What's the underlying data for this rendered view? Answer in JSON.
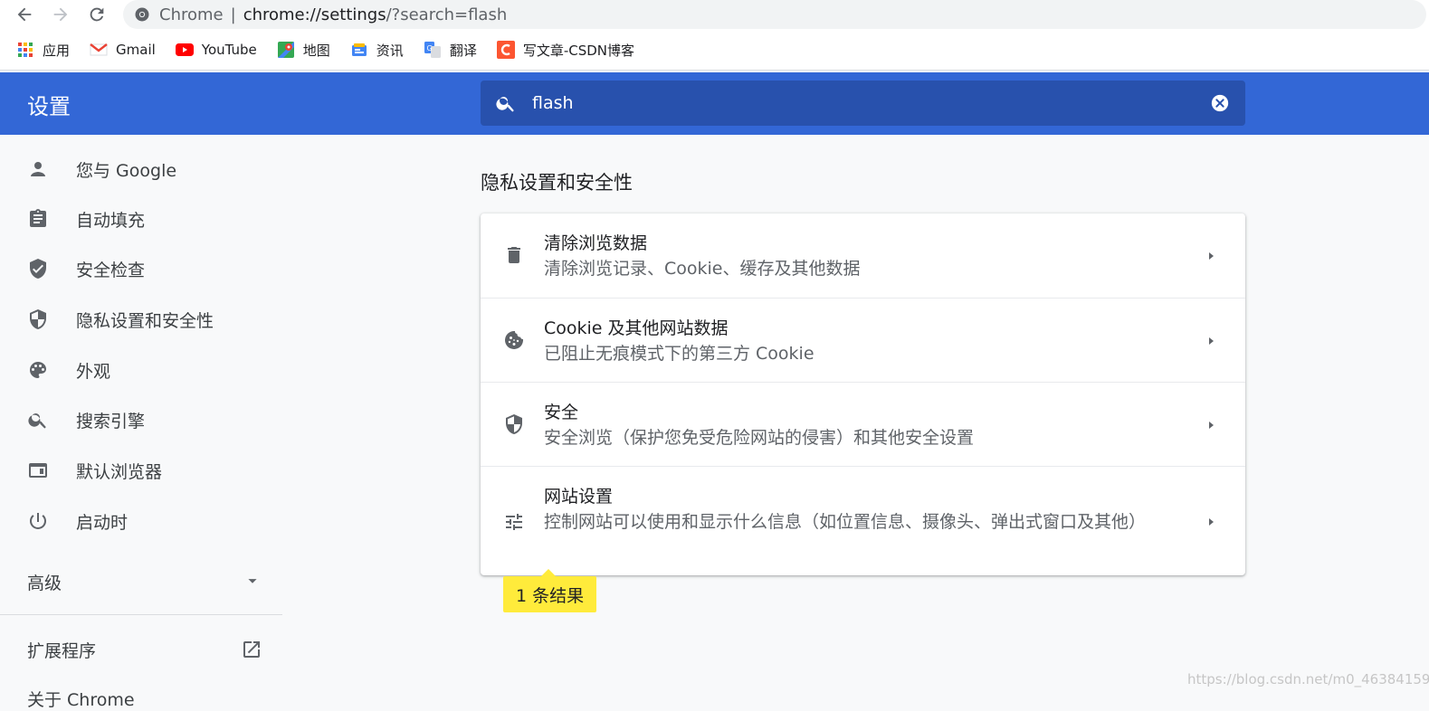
{
  "browser": {
    "scheme_label": "Chrome",
    "url_host": "chrome://settings",
    "url_rest": "/?search=flash"
  },
  "bookmarks": [
    {
      "label": "应用",
      "icon": "apps-grid-icon"
    },
    {
      "label": "Gmail",
      "icon": "gmail-icon"
    },
    {
      "label": "YouTube",
      "icon": "youtube-icon"
    },
    {
      "label": "地图",
      "icon": "maps-icon"
    },
    {
      "label": "资讯",
      "icon": "news-icon"
    },
    {
      "label": "翻译",
      "icon": "translate-icon"
    },
    {
      "label": "写文章-CSDN博客",
      "icon": "csdn-icon"
    }
  ],
  "header": {
    "title": "设置",
    "search_value": "flash"
  },
  "sidebar": {
    "items": [
      {
        "label": "您与 Google",
        "icon": "person-icon"
      },
      {
        "label": "自动填充",
        "icon": "clipboard-icon"
      },
      {
        "label": "安全检查",
        "icon": "shield-check-icon"
      },
      {
        "label": "隐私设置和安全性",
        "icon": "shield-half-icon"
      },
      {
        "label": "外观",
        "icon": "palette-icon"
      },
      {
        "label": "搜索引擎",
        "icon": "search-icon"
      },
      {
        "label": "默认浏览器",
        "icon": "browser-window-icon"
      },
      {
        "label": "启动时",
        "icon": "power-icon"
      }
    ],
    "advanced_label": "高级",
    "extensions_label": "扩展程序",
    "about_label": "关于 Chrome"
  },
  "main": {
    "section_title": "隐私设置和安全性",
    "rows": [
      {
        "title": "清除浏览数据",
        "subtitle": "清除浏览记录、Cookie、缓存及其他数据",
        "icon": "trash-icon"
      },
      {
        "title": "Cookie 及其他网站数据",
        "subtitle": "已阻止无痕模式下的第三方 Cookie",
        "icon": "cookie-icon"
      },
      {
        "title": "安全",
        "subtitle": "安全浏览（保护您免受危险网站的侵害）和其他安全设置",
        "icon": "shield-half-icon"
      },
      {
        "title": "网站设置",
        "subtitle": "控制网站可以使用和显示什么信息（如位置信息、摄像头、弹出式窗口及其他）",
        "icon": "tune-icon"
      }
    ],
    "result_badge": "1 条结果"
  },
  "watermark": "https://blog.csdn.net/m0_46384159",
  "colors": {
    "header_bg": "#3367d6",
    "search_bg": "#2851ad",
    "badge_bg": "#ffeb3b",
    "icon_gray": "#5f6368"
  }
}
